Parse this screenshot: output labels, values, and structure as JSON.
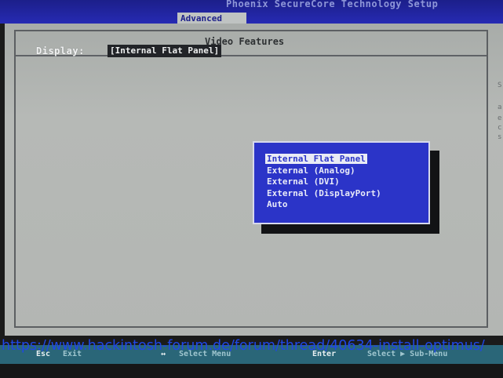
{
  "topbar": {
    "title": "Phoenix SecureCore Technology Setup",
    "active_tab": "Advanced"
  },
  "panel": {
    "section_title": "Video Features",
    "right_column_glyphs": [
      "S",
      "a",
      "e",
      "c",
      "s"
    ]
  },
  "setting": {
    "label": "Display:",
    "value": "[Internal Flat Panel]"
  },
  "popup": {
    "options": [
      {
        "label": "Internal Flat Panel",
        "selected": true
      },
      {
        "label": "External (Analog)",
        "selected": false
      },
      {
        "label": "External (DVI)",
        "selected": false
      },
      {
        "label": "External (DisplayPort)",
        "selected": false
      },
      {
        "label": "Auto",
        "selected": false
      }
    ]
  },
  "statusbar": {
    "esc_key": "Esc",
    "esc_label": "Exit",
    "arrows_key": "↔",
    "arrows_label": "Select Menu",
    "enter_key": "Enter",
    "enter_label": "Select ▶ Sub-Menu"
  },
  "watermark": {
    "url": "https://www.hackintosh-forum.de/forum/thread/40634-install-optimus/"
  },
  "colors": {
    "title_bar": "#262ab3",
    "panel_gray": "#b3b6b3",
    "popup_blue": "#2b34c8",
    "status_bar": "#2a6678",
    "watermark_link": "#1f47e6"
  }
}
